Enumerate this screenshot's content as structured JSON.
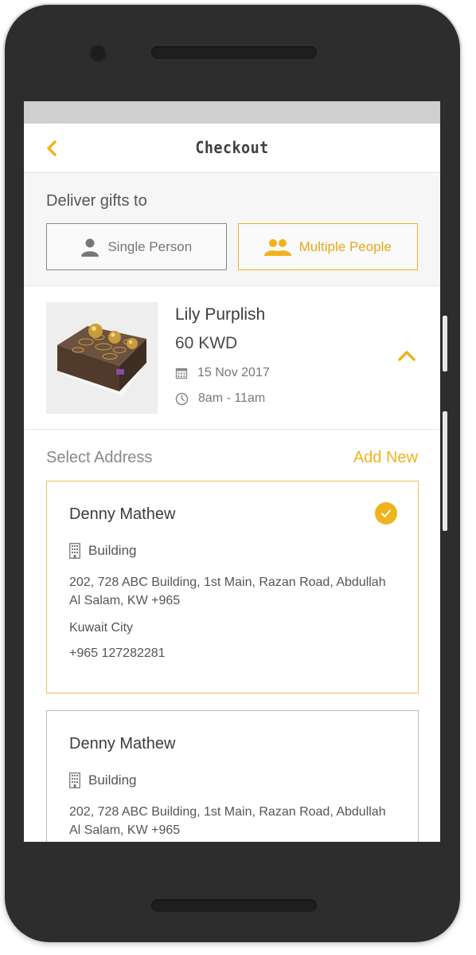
{
  "header": {
    "title": "Checkout"
  },
  "deliver": {
    "label": "Deliver gifts to",
    "options": [
      {
        "label": "Single Person",
        "icon": "person-icon",
        "selected": false
      },
      {
        "label": "Multiple People",
        "icon": "people-icon",
        "selected": true
      }
    ]
  },
  "product": {
    "name": "Lily Purplish",
    "price": "60 KWD",
    "date": "15 Nov 2017",
    "time": "8am - 11am"
  },
  "addresses": {
    "label": "Select Address",
    "add_new": "Add New",
    "items": [
      {
        "name": "Denny Mathew",
        "type": "Building",
        "address": "202, 728 ABC Building, 1st Main, Razan Road, Abdullah Al Salam, KW +965",
        "city": "Kuwait City",
        "phone": "+965 127282281",
        "selected": true
      },
      {
        "name": "Denny Mathew",
        "type": "Building",
        "address": "202, 728 ABC Building, 1st Main, Razan Road, Abdullah Al Salam, KW +965",
        "selected": false
      }
    ]
  },
  "colors": {
    "accent": "#f0b21e",
    "text": "#444444",
    "border": "#bbbbbb"
  }
}
